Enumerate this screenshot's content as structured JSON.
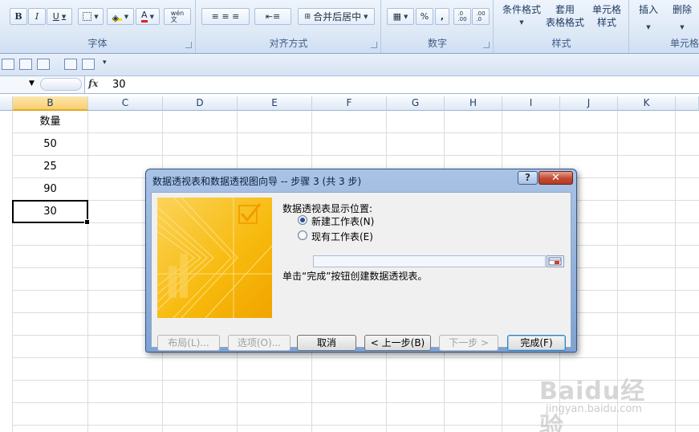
{
  "ribbon": {
    "font_group": {
      "label": "字体",
      "bold": "B",
      "italic": "I",
      "underline": "U",
      "font_color": "A",
      "phonetic": "wén\n文"
    },
    "align_group": {
      "label": "对齐方式",
      "merge_center": "合并后居中"
    },
    "number_group": {
      "label": "数字",
      "percent": "%",
      "comma": ",",
      "inc_decimal": ".0\n.00",
      "dec_decimal": ".00\n.0"
    },
    "styles_group": {
      "label": "样式",
      "conditional_format": "条件格式",
      "table_format": "套用\n表格格式",
      "cell_styles": "单元格\n样式"
    },
    "cells_group": {
      "label": "单元格",
      "insert": "插入",
      "delete": "删除"
    }
  },
  "formula_bar": {
    "fx": "fx",
    "value": "30"
  },
  "columns": [
    "B",
    "C",
    "D",
    "E",
    "F",
    "G",
    "H",
    "I",
    "J",
    "K"
  ],
  "cells": {
    "header": "数量",
    "values": [
      "50",
      "25",
      "90",
      "30"
    ]
  },
  "dialog": {
    "title": "数据透视表和数据透视图向导 -- 步骤 3 (共 3 步)",
    "help": "?",
    "close": "✕",
    "location_label": "数据透视表显示位置:",
    "option_new": "新建工作表(N)",
    "option_existing": "现有工作表(E)",
    "range_value": "",
    "hint": "单击“完成”按钮创建数据透视表。",
    "buttons": {
      "layout": "布局(L)...",
      "options": "选项(O)...",
      "cancel": "取消",
      "back": "< 上一步(B)",
      "next": "下一步 >",
      "finish": "完成(F)"
    }
  },
  "watermark": {
    "logo": "Baidu经验",
    "url": "jingyan.baidu.com"
  },
  "colors": {
    "accent_orange": "#f7b90c",
    "selected_header": "#f9cf6e",
    "ribbon_text": "#3e5c87"
  }
}
